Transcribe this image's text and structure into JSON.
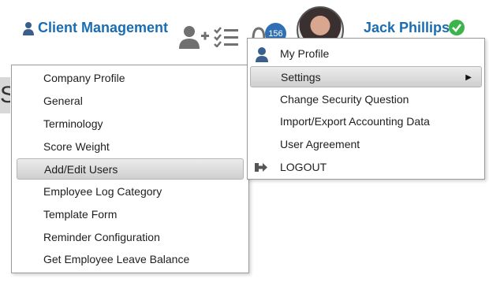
{
  "header": {
    "title": "Client Management",
    "notification_count": "156",
    "user_name": "Jack Phillips"
  },
  "background_letter": "S",
  "user_menu": {
    "items": [
      {
        "label": "My Profile",
        "icon": "user-icon"
      },
      {
        "label": "Settings",
        "has_submenu": true
      },
      {
        "label": "Change Security Question"
      },
      {
        "label": "Import/Export Accounting Data"
      },
      {
        "label": "User Agreement"
      },
      {
        "label": "LOGOUT",
        "icon": "logout-icon"
      }
    ]
  },
  "settings_submenu": {
    "items": [
      {
        "label": "Company Profile"
      },
      {
        "label": "General"
      },
      {
        "label": "Terminology"
      },
      {
        "label": "Score Weight"
      },
      {
        "label": "Add/Edit Users"
      },
      {
        "label": "Employee Log Category"
      },
      {
        "label": "Template Form"
      },
      {
        "label": "Reminder Configuration"
      },
      {
        "label": "Get Employee Leave Balance"
      }
    ]
  },
  "colors": {
    "brand_blue": "#1a6db3",
    "badge_blue": "#2f6fb3",
    "check_green": "#3bb54a"
  }
}
